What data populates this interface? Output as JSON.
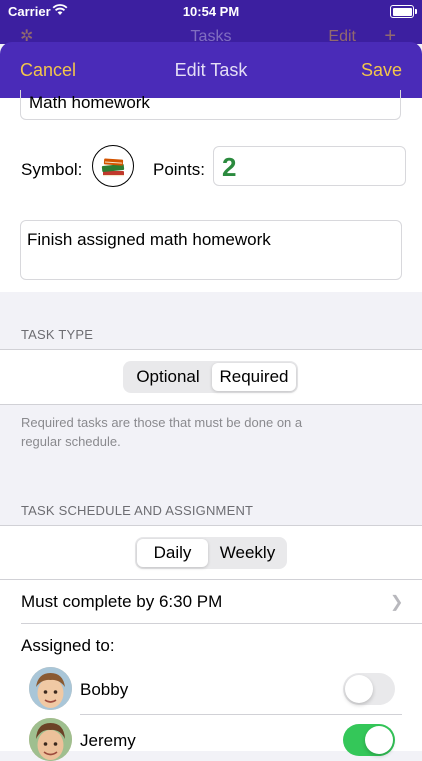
{
  "status_bar": {
    "carrier": "Carrier",
    "time": "10:54 PM"
  },
  "background_screen": {
    "title": "Tasks",
    "edit_label": "Edit",
    "add_label": "+"
  },
  "nav": {
    "cancel_label": "Cancel",
    "title": "Edit Task",
    "save_label": "Save"
  },
  "task": {
    "name": "Math homework",
    "symbol_label": "Symbol:",
    "symbol_icon": "books-icon",
    "points_label": "Points:",
    "points_value": "2",
    "description": "Finish assigned math homework"
  },
  "task_type": {
    "header": "TASK TYPE",
    "options": [
      "Optional",
      "Required"
    ],
    "selected": "Required",
    "footnote": "Required tasks are those that must be done on a regular schedule."
  },
  "schedule": {
    "header": "TASK SCHEDULE AND ASSIGNMENT",
    "options": [
      "Daily",
      "Weekly"
    ],
    "selected": "Daily",
    "deadline": "Must complete by 6:30 PM",
    "assigned_label": "Assigned to:",
    "people": [
      {
        "name": "Bobby",
        "assigned": false
      },
      {
        "name": "Jeremy",
        "assigned": true
      }
    ]
  },
  "colors": {
    "nav_background": "#4a2bb8",
    "nav_accent": "#f2c54b",
    "points_color": "#2b8a3e",
    "toggle_on": "#34c759"
  }
}
